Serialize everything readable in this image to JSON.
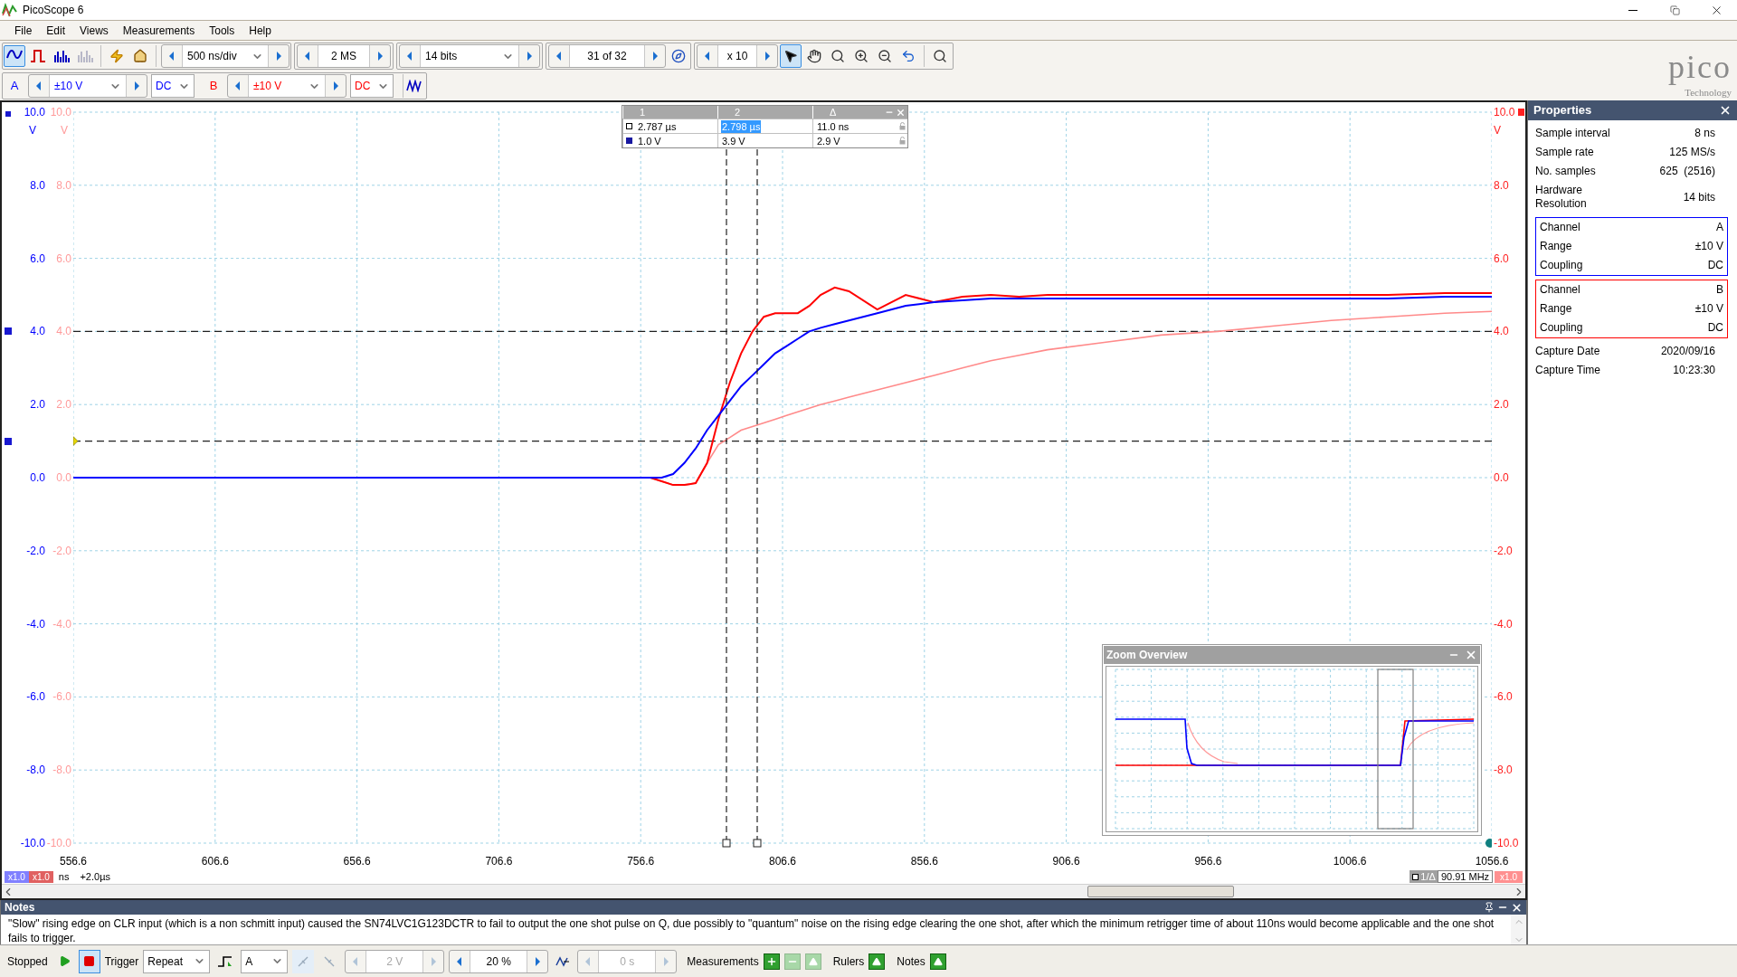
{
  "window": {
    "title": "PicoScope 6"
  },
  "menu": [
    "File",
    "Edit",
    "Views",
    "Measurements",
    "Tools",
    "Help"
  ],
  "view_modes": [
    {
      "kind": "scope",
      "selected": true,
      "disabled": false
    },
    {
      "kind": "persistence",
      "selected": false,
      "disabled": false
    },
    {
      "kind": "spectrum",
      "selected": false,
      "disabled": false
    },
    {
      "kind": "histogram",
      "selected": false,
      "disabled": true
    }
  ],
  "timebase": "500 ns/div",
  "samples": "2 MS",
  "resolution": "14 bits",
  "buffer": "31 of 32",
  "zoom_factor": "x 10",
  "tools": [
    {
      "kind": "pointer",
      "selected": true
    },
    {
      "kind": "hand",
      "selected": false
    },
    {
      "kind": "zoom-area",
      "selected": false
    },
    {
      "kind": "zoom-in",
      "selected": false
    },
    {
      "kind": "zoom-out",
      "selected": false
    },
    {
      "kind": "undo",
      "selected": false
    },
    {
      "kind": "zoom-fit",
      "selected": false
    }
  ],
  "logo": {
    "name": "pico",
    "tagline": "Technology"
  },
  "channels": [
    {
      "label": "A",
      "range": "±10 V",
      "coupling": "DC",
      "color": "#0000ff"
    },
    {
      "label": "B",
      "range": "±10 V",
      "coupling": "DC",
      "color": "#ff0000"
    }
  ],
  "cursor_table": {
    "columns": [
      "1",
      "2",
      "Δ"
    ],
    "rows": [
      {
        "kind": "time",
        "cells": [
          {
            "text": "2.787 µs",
            "selected": false
          },
          {
            "text": "2.798 µs",
            "selected": true
          },
          {
            "text": "11.0 ns",
            "selected": false
          }
        ]
      },
      {
        "kind": "voltage",
        "cells": [
          {
            "text": "1.0 V",
            "selected": false
          },
          {
            "text": "3.9 V",
            "selected": false
          },
          {
            "text": "2.9 V",
            "selected": false
          }
        ]
      }
    ]
  },
  "plot": {
    "b_ticks": [
      "10.0",
      "8.0",
      "6.0",
      "4.0",
      "2.0",
      "0.0",
      "-2.0",
      "-4.0",
      "-6.0",
      "-8.0",
      "-10.0"
    ],
    "right_ticks": [
      "10.0",
      "8.0",
      "6.0",
      "4.0",
      "2.0",
      "0.0",
      "-2.0",
      "-4.0",
      "-6.0",
      "-8.0",
      "-10.0"
    ],
    "a_unit": "V",
    "b_unit": "V",
    "right_unit": "V",
    "chart_data": {
      "type": "line",
      "grid": true,
      "xlim": [
        556.6,
        1056.6
      ],
      "ylim": [
        -10,
        10
      ],
      "xticks": [
        {
          "value": 556.6,
          "label": "556.6"
        },
        {
          "value": 606.6,
          "label": "606.6"
        },
        {
          "value": 656.6,
          "label": "656.6"
        },
        {
          "value": 706.6,
          "label": "706.6"
        },
        {
          "value": 756.6,
          "label": "756.6"
        },
        {
          "value": 806.6,
          "label": "806.6"
        },
        {
          "value": 856.6,
          "label": "856.6"
        },
        {
          "value": 906.6,
          "label": "906.6"
        },
        {
          "value": 956.6,
          "label": "956.6"
        },
        {
          "value": 1006.6,
          "label": "1006.6"
        },
        {
          "value": 1056.6,
          "label": "1056.6"
        }
      ],
      "yticks": [
        {
          "value": 10,
          "label": "10.0"
        },
        {
          "value": 8,
          "label": "8.0"
        },
        {
          "value": 6,
          "label": "6.0"
        },
        {
          "value": 4,
          "label": "4.0"
        },
        {
          "value": 2,
          "label": "2.0"
        },
        {
          "value": 0,
          "label": "0.0"
        },
        {
          "value": -2,
          "label": "-2.0"
        },
        {
          "value": -4,
          "label": "-4.0"
        },
        {
          "value": -6,
          "label": "-6.0"
        },
        {
          "value": -8,
          "label": "-8.0"
        },
        {
          "value": -10,
          "label": "-10.0"
        }
      ],
      "x": [
        556.6,
        576.6,
        596.6,
        616.6,
        636.6,
        656.6,
        676.6,
        696.6,
        716.6,
        736.6,
        756.6,
        760,
        764,
        768,
        772,
        776,
        780,
        784,
        788,
        792,
        796,
        800,
        804,
        808,
        812,
        816,
        820,
        825,
        830,
        840,
        850,
        860,
        870,
        880,
        890,
        900,
        920,
        940,
        960,
        980,
        1000,
        1020,
        1040,
        1056.6
      ],
      "series": [
        {
          "color": "#ff8a8a",
          "values": [
            null,
            null,
            null,
            null,
            null,
            null,
            null,
            null,
            null,
            null,
            0,
            0,
            -0.1,
            -0.2,
            -0.2,
            -0.15,
            0.4,
            0.9,
            1.1,
            1.3,
            1.4,
            1.5,
            1.6,
            1.7,
            1.8,
            1.9,
            2.0,
            2.1,
            2.2,
            2.4,
            2.6,
            2.8,
            3.0,
            3.2,
            3.35,
            3.5,
            3.7,
            3.9,
            4.0,
            4.15,
            4.3,
            4.4,
            4.5,
            4.55
          ]
        },
        {
          "color": "#ff0000",
          "values": [
            null,
            null,
            null,
            null,
            null,
            null,
            null,
            null,
            null,
            null,
            0,
            0,
            -0.1,
            -0.2,
            -0.2,
            -0.15,
            0.4,
            1.6,
            2.6,
            3.4,
            4.0,
            4.4,
            4.5,
            4.5,
            4.5,
            4.7,
            5.0,
            5.2,
            5.1,
            4.6,
            5.0,
            4.8,
            4.95,
            5.0,
            4.95,
            5.0,
            5.0,
            5.0,
            5.0,
            5.0,
            5.0,
            5.0,
            5.05,
            5.05
          ]
        },
        {
          "color": "#0000ff",
          "values": [
            0,
            0,
            0,
            0,
            0,
            0,
            0,
            0,
            0,
            0,
            0,
            0,
            0,
            0.1,
            0.4,
            0.8,
            1.3,
            1.7,
            2.1,
            2.5,
            2.8,
            3.1,
            3.4,
            3.6,
            3.8,
            4.0,
            4.1,
            4.2,
            4.3,
            4.5,
            4.7,
            4.8,
            4.85,
            4.9,
            4.9,
            4.9,
            4.9,
            4.9,
            4.9,
            4.9,
            4.9,
            4.9,
            4.95,
            4.95
          ]
        }
      ]
    },
    "a_scale": "x1.0",
    "b_scale": "x1.0",
    "x_unit": "ns",
    "offset": "+2.0µs",
    "freq_label": "1/Δ",
    "freq": "90.91 MHz",
    "right_scale": "x1.0"
  },
  "zoom_overview": {
    "title": "Zoom Overview"
  },
  "properties": {
    "title": "Properties",
    "rows": [
      {
        "label": "Sample interval",
        "value": "8 ns"
      },
      {
        "label": "Sample rate",
        "value": "125 MS/s"
      },
      {
        "label": "No. samples",
        "value": "625  (2516)"
      },
      {
        "label": "Hardware Resolution",
        "value": "14 bits"
      }
    ],
    "channel_groups": [
      {
        "color": "#0000ff",
        "rows": [
          {
            "label": "Channel",
            "value": "A"
          },
          {
            "label": "Range",
            "value": "±10 V"
          },
          {
            "label": "Coupling",
            "value": "DC"
          }
        ]
      },
      {
        "color": "#ff0000",
        "rows": [
          {
            "label": "Channel",
            "value": "B"
          },
          {
            "label": "Range",
            "value": "±10 V"
          },
          {
            "label": "Coupling",
            "value": "DC"
          }
        ]
      }
    ],
    "capture": [
      {
        "label": "Capture Date",
        "value": "2020/09/16"
      },
      {
        "label": "Capture Time",
        "value": "10:23:30"
      }
    ]
  },
  "notes": {
    "title": "Notes",
    "text": "\"Slow\" rising edge on CLR input (which is a non schmitt input) caused the SN74LVC1G123DCTR to fail to output the one shot pulse on Q, due possibly to \"quantum\" noise on the rising edge clearing the one shot, after which the minimum retrigger time of about 110ns would become applicable and the one shot fails to trigger."
  },
  "status": {
    "state": "Stopped",
    "trigger_label": "Trigger",
    "trigger_mode": "Repeat",
    "trigger_source": "A",
    "spinners": [
      {
        "value": "2 V",
        "disabled": true
      },
      {
        "value": "20 %",
        "disabled": false
      },
      {
        "value": "0 s",
        "disabled": true
      }
    ],
    "measurements": "Measurements",
    "rulers": "Rulers",
    "notes": "Notes"
  }
}
